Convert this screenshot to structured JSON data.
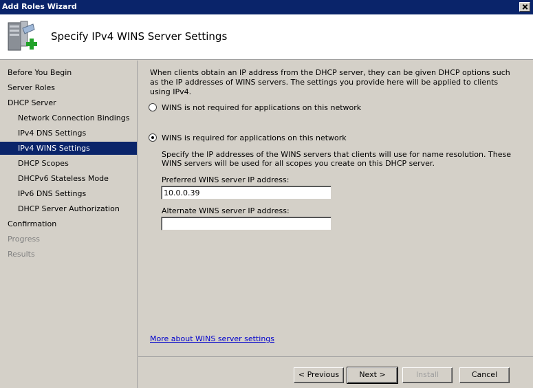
{
  "window": {
    "title": "Add Roles Wizard",
    "page_title": "Specify IPv4 WINS Server Settings"
  },
  "nav": {
    "items": [
      {
        "label": "Before You Begin"
      },
      {
        "label": "Server Roles"
      },
      {
        "label": "DHCP Server"
      },
      {
        "label": "Network Connection Bindings"
      },
      {
        "label": "IPv4 DNS Settings"
      },
      {
        "label": "IPv4 WINS Settings"
      },
      {
        "label": "DHCP Scopes"
      },
      {
        "label": "DHCPv6 Stateless Mode"
      },
      {
        "label": "IPv6 DNS Settings"
      },
      {
        "label": "DHCP Server Authorization"
      },
      {
        "label": "Confirmation"
      },
      {
        "label": "Progress"
      },
      {
        "label": "Results"
      }
    ]
  },
  "content": {
    "intro": "When clients obtain an IP address from the DHCP server, they can be given DHCP options such as the IP addresses of WINS servers. The settings you provide here will be applied to clients using IPv4.",
    "option_not_required": "WINS is not required for applications on this network",
    "option_required": "WINS is required for applications on this network",
    "helper": "Specify the IP addresses of the WINS servers that clients will use for name resolution. These WINS servers will be used for all scopes you create on this DHCP server.",
    "preferred_label": "Preferred WINS server IP address:",
    "preferred_value": "10.0.0.39",
    "alternate_label": "Alternate WINS server IP address:",
    "alternate_value": "",
    "more_link": "More about WINS server settings"
  },
  "buttons": {
    "previous": "< Previous",
    "next": "Next >",
    "install": "Install",
    "cancel": "Cancel"
  },
  "icons": {
    "wizard": "server-add-icon",
    "close": "close-icon"
  }
}
